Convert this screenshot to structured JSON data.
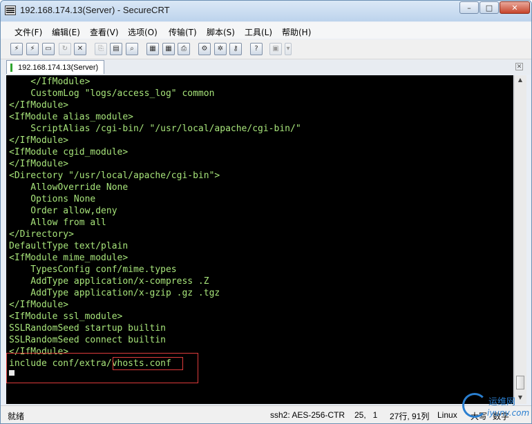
{
  "window": {
    "title": "192.168.174.13(Server) - SecureCRT",
    "min": "–",
    "max": "□",
    "close": "✕"
  },
  "menu": [
    "文件(F)",
    "编辑(E)",
    "查看(V)",
    "选项(O)",
    "传输(T)",
    "脚本(S)",
    "工具(L)",
    "帮助(H)"
  ],
  "tab": {
    "label": "192.168.174.13(Server)",
    "close": "✕"
  },
  "terminal": {
    "lines": [
      "    </IfModule>",
      "    CustomLog \"logs/access_log\" common",
      "</IfModule>",
      "<IfModule alias_module>",
      "    ScriptAlias /cgi-bin/ \"/usr/local/apache/cgi-bin/\"",
      "</IfModule>",
      "<IfModule cgid_module>",
      "</IfModule>",
      "<Directory \"/usr/local/apache/cgi-bin\">",
      "    AllowOverride None",
      "    Options None",
      "    Order allow,deny",
      "    Allow from all",
      "</Directory>",
      "DefaultType text/plain",
      "<IfModule mime_module>",
      "    TypesConfig conf/mime.types",
      "    AddType application/x-compress .Z",
      "    AddType application/x-gzip .gz .tgz",
      "</IfModule>",
      "<IfModule ssl_module>",
      "SSLRandomSeed startup builtin",
      "SSLRandomSeed connect builtin",
      "</IfModule>",
      "include conf/extra/vhosts.conf"
    ],
    "color": "#a7e47a"
  },
  "statusbar": {
    "ready": "就绪",
    "cipher": "ssh2: AES-256-CTR",
    "position": "25,   1",
    "size": "27行, 91列",
    "os": "Linux",
    "caps": "大写",
    "num": "数字"
  },
  "watermark": {
    "text1": "运维网",
    "text2": "iyunv.com"
  }
}
